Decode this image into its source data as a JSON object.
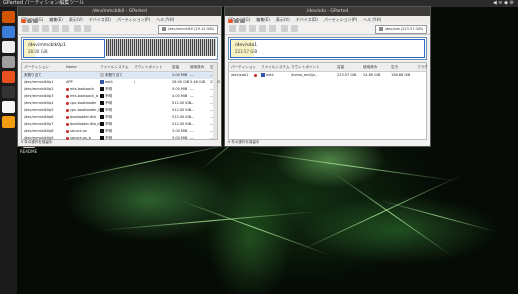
{
  "topbar": {
    "app_title": "GParted パーティション編集ツール",
    "tray": "◀ ≋ ◆ ⚙"
  },
  "desktop": {
    "icon_label": "README"
  },
  "launcher": {
    "colors": [
      "#d35400",
      "#3b7dd8",
      "#eeeeee",
      "#9e9e9e",
      "#e8501e",
      "#333333",
      "#f5f5f5",
      "#f39c12"
    ]
  },
  "left": {
    "title": "/dev/mmcblk0 - GParted",
    "menu": [
      "GParted(G)",
      "編集(E)",
      "表示(V)",
      "デバイス(D)",
      "パーティション(P)",
      "ヘルプ(H)"
    ],
    "device": "/dev/mmcblk0 (29.12 GiB)",
    "disk": {
      "name": "/dev/mmcblk0p1",
      "size": "28.00 GiB"
    },
    "headers": [
      "パーティション",
      "Name",
      "ファイルシステム",
      "マウントポイント",
      "容量",
      "使用済み",
      "空き"
    ],
    "rows": [
      {
        "p": "未割り当て",
        "n": "",
        "fs": "未割り当て",
        "fc": "#c0c0c0",
        "mp": "",
        "size": "2.00 MiB",
        "used": "---",
        "free": "---",
        "lock": false,
        "sel": true
      },
      {
        "p": "/dev/mmcblk0p1",
        "n": "APP",
        "fs": "ext4",
        "fc": "#3355aa",
        "mp": "/",
        "size": "28.00 GiB",
        "used": "5.46 GiB",
        "free": "22.53 GiB",
        "lock": false,
        "sel": false
      },
      {
        "p": "/dev/mmcblk0p2",
        "n": "mts-bootpack",
        "fs": "不明",
        "fc": "#111111",
        "mp": "",
        "size": "4.00 MiB",
        "used": "---",
        "free": "---",
        "lock": true,
        "sel": false
      },
      {
        "p": "/dev/mmcblk0p3",
        "n": "mts-bootpack_b",
        "fs": "不明",
        "fc": "#111111",
        "mp": "",
        "size": "4.00 MiB",
        "used": "---",
        "free": "---",
        "lock": true,
        "sel": false
      },
      {
        "p": "/dev/mmcblk0p4",
        "n": "cpu-bootloader",
        "fs": "不明",
        "fc": "#111111",
        "mp": "",
        "size": "512.00 KiB",
        "used": "---",
        "free": "---",
        "lock": true,
        "sel": false
      },
      {
        "p": "/dev/mmcblk0p5",
        "n": "cpu-bootloader_b",
        "fs": "不明",
        "fc": "#111111",
        "mp": "",
        "size": "512.00 KiB",
        "used": "---",
        "free": "---",
        "lock": true,
        "sel": false
      },
      {
        "p": "/dev/mmcblk0p6",
        "n": "bootloader-dtb",
        "fs": "不明",
        "fc": "#111111",
        "mp": "",
        "size": "512.00 KiB",
        "used": "---",
        "free": "---",
        "lock": true,
        "sel": false
      },
      {
        "p": "/dev/mmcblk0p7",
        "n": "bootloader-dtb_b",
        "fs": "不明",
        "fc": "#111111",
        "mp": "",
        "size": "512.00 KiB",
        "used": "---",
        "free": "---",
        "lock": true,
        "sel": false
      },
      {
        "p": "/dev/mmcblk0p8",
        "n": "secure-os",
        "fs": "不明",
        "fc": "#111111",
        "mp": "",
        "size": "3.00 MiB",
        "used": "---",
        "free": "---",
        "lock": true,
        "sel": false
      },
      {
        "p": "/dev/mmcblk0p9",
        "n": "secure-os_b",
        "fs": "不明",
        "fc": "#111111",
        "mp": "",
        "size": "3.00 MiB",
        "used": "---",
        "free": "---",
        "lock": true,
        "sel": false
      }
    ],
    "status": "0 件の操作を保留中"
  },
  "right": {
    "title": "/dev/sda - GParted",
    "menu": [
      "GParted(G)",
      "編集(E)",
      "表示(V)",
      "デバイス(D)",
      "パーティション(P)",
      "ヘルプ(H)"
    ],
    "device": "/dev/sda (223.57 GiB)",
    "disk": {
      "name": "/dev/sda1",
      "size": "223.57 GiB"
    },
    "headers": [
      "パーティション",
      "ファイルシステム",
      "マウントポイント",
      "容量",
      "使用済み",
      "空き",
      "フラグ"
    ],
    "rows": [
      {
        "p": "/dev/sda1",
        "lock": true,
        "fs": "ext4",
        "fc": "#3355aa",
        "mp": "/home_mnt/ju...",
        "size": "223.57 GiB",
        "used": "24.89 GiB",
        "free": "198.68 GiB",
        "flag": ""
      }
    ],
    "status": "0 件の操作を保留中"
  }
}
